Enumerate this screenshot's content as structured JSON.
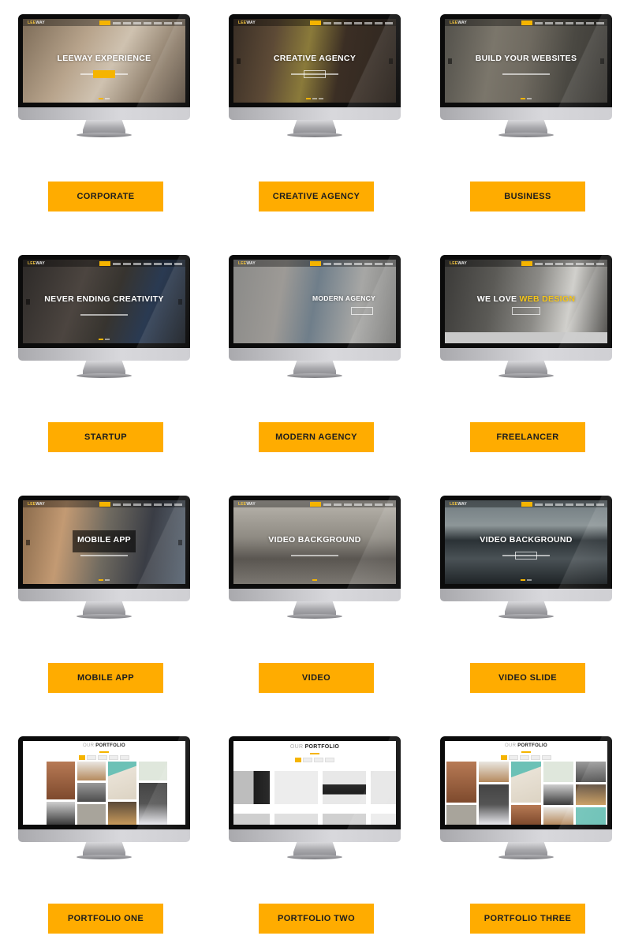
{
  "accent_color": "#ffac00",
  "templates": [
    {
      "label": "CORPORATE",
      "hero_title": "LEEWAY EXPERIENCE",
      "type": "hero",
      "bg": "corporate",
      "button": "filled"
    },
    {
      "label": "CREATIVE AGENCY",
      "hero_title": "CREATIVE AGENCY",
      "type": "hero",
      "bg": "creative",
      "button": "outline"
    },
    {
      "label": "BUSINESS",
      "hero_title": "BUILD YOUR WEBSITES",
      "type": "hero",
      "bg": "business",
      "button": "none"
    },
    {
      "label": "STARTUP",
      "hero_title": "NEVER ENDING CREATIVITY",
      "type": "hero",
      "bg": "startup",
      "button": "none"
    },
    {
      "label": "MODERN AGENCY",
      "hero_title": "MODERN AGENCY",
      "type": "hero",
      "bg": "modern",
      "button": "outline"
    },
    {
      "label": "FREELANCER",
      "hero_title_plain": "WE LOVE ",
      "hero_title_highlight": "WEB DESIGN",
      "type": "hero",
      "bg": "freelancer",
      "button": "outline"
    },
    {
      "label": "MOBILE APP",
      "hero_title": "MOBILE APP",
      "type": "hero",
      "bg": "mobile",
      "button": "none"
    },
    {
      "label": "VIDEO",
      "hero_title": "VIDEO BACKGROUND",
      "type": "hero",
      "bg": "video",
      "button": "none"
    },
    {
      "label": "VIDEO SLIDE",
      "hero_title": "VIDEO BACKGROUND",
      "type": "hero",
      "bg": "videoslide",
      "button": "outline"
    },
    {
      "label": "PORTFOLIO ONE",
      "portfolio_title_light": "OUR ",
      "portfolio_title_bold": "PORTFOLIO",
      "type": "portfolio"
    },
    {
      "label": "PORTFOLIO TWO",
      "portfolio_title_light": "OUR ",
      "portfolio_title_bold": "PORTFOLIO",
      "type": "portfolio"
    },
    {
      "label": "PORTFOLIO THREE",
      "portfolio_title_light": "OUR ",
      "portfolio_title_bold": "PORTFOLIO",
      "type": "portfolio"
    }
  ],
  "logo": {
    "accent": "LEE",
    "rest": "WAY"
  }
}
